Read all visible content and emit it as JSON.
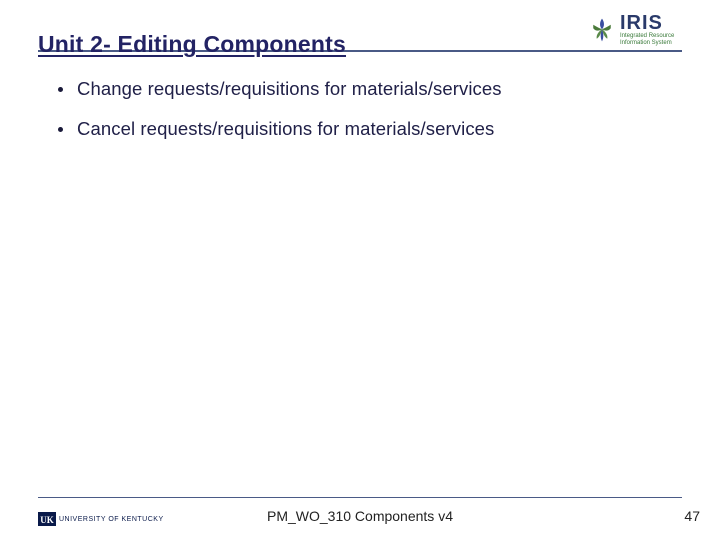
{
  "header": {
    "title": "Unit 2- Editing Components"
  },
  "logo": {
    "name": "IRIS",
    "tagline1": "Integrated Resource",
    "tagline2": "Information System"
  },
  "bullets": [
    "Change requests/requisitions for materials/services",
    "Cancel requests/requisitions for materials/services"
  ],
  "footer": {
    "org": "UNIVERSITY OF KENTUCKY",
    "doc": "PM_WO_310 Components v4",
    "page": "47"
  }
}
